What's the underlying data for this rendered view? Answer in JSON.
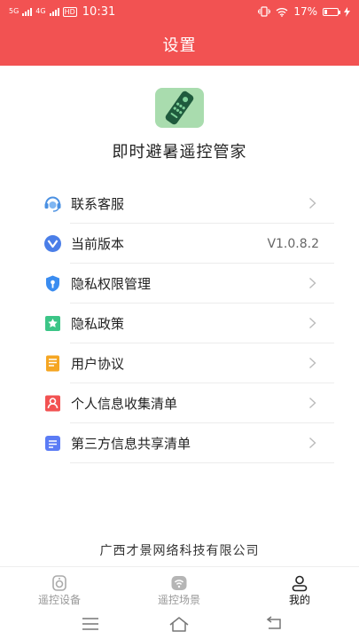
{
  "status_bar": {
    "signal_1": "5G",
    "signal_2": "4G",
    "hd": "HD",
    "time": "10:31",
    "battery": "17%"
  },
  "header": {
    "title": "设置"
  },
  "app": {
    "name": "即时避暑遥控管家",
    "logo_icon": "remote-control-icon"
  },
  "menu": {
    "items": [
      {
        "label": "联系客服",
        "icon": "customer-service-icon",
        "color": "#4a90e2"
      },
      {
        "label": "当前版本",
        "icon": "version-icon",
        "value": "V1.0.8.2",
        "color": "#4a7ee8"
      },
      {
        "label": "隐私权限管理",
        "icon": "privacy-shield-icon",
        "color": "#3a8cf0"
      },
      {
        "label": "隐私政策",
        "icon": "policy-icon",
        "color": "#3cc587"
      },
      {
        "label": "用户协议",
        "icon": "agreement-icon",
        "color": "#f5a623"
      },
      {
        "label": "个人信息收集清单",
        "icon": "personal-info-icon",
        "color": "#f25252"
      },
      {
        "label": "第三方信息共享清单",
        "icon": "third-party-icon",
        "color": "#5b7cf5"
      }
    ]
  },
  "footer": {
    "company": "广西才景网络科技有限公司"
  },
  "tabs": [
    {
      "label": "遥控设备",
      "icon": "remote-device-icon",
      "active": false
    },
    {
      "label": "遥控场景",
      "icon": "remote-scene-icon",
      "active": false
    },
    {
      "label": "我的",
      "icon": "profile-icon",
      "active": true
    }
  ],
  "colors": {
    "accent": "#f25252",
    "tab_inactive": "#999999",
    "tab_active": "#111111"
  }
}
